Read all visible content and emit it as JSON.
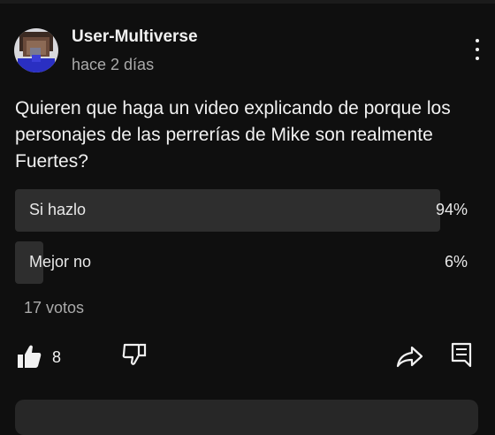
{
  "post": {
    "author": "User-Multiverse",
    "time": "hace 2 días",
    "question": "Quieren que haga un video explicando de porque los personajes de las perrerías de Mike son realmente Fuertes?"
  },
  "poll": {
    "options": [
      {
        "label": "Si hazlo",
        "percent_text": "94%",
        "percent": 94
      },
      {
        "label": "Mejor no",
        "percent_text": "6%",
        "percent": 6
      }
    ],
    "votes": "17 votos"
  },
  "actions": {
    "like_count": "8",
    "icons": [
      "thumbs-up-icon",
      "thumbs-down-icon",
      "share-icon",
      "reply-icon",
      "more-vert-icon"
    ]
  },
  "colors": {
    "background": "#0f0f0f",
    "poll_fill": "#2e2e2e",
    "secondary_text": "#aaaaaa"
  }
}
